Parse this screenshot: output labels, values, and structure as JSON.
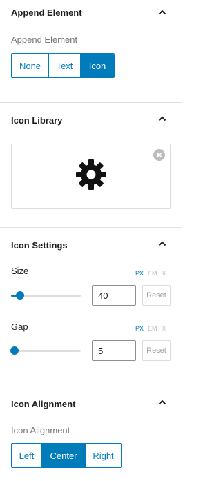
{
  "append_element": {
    "title": "Append Element",
    "field_label": "Append Element",
    "options": [
      "None",
      "Text",
      "Icon"
    ],
    "selected": "Icon"
  },
  "icon_library": {
    "title": "Icon Library",
    "icon": "gear-icon"
  },
  "icon_settings": {
    "title": "Icon Settings",
    "units": [
      "PX",
      "EM",
      "%"
    ],
    "size": {
      "label": "Size",
      "value": "40",
      "unit": "PX",
      "slider_fraction": 0.13,
      "reset_label": "Reset"
    },
    "gap": {
      "label": "Gap",
      "value": "5",
      "unit": "PX",
      "slider_fraction": 0.05,
      "reset_label": "Reset"
    }
  },
  "icon_alignment": {
    "title": "Icon Alignment",
    "field_label": "Icon Alignment",
    "options": [
      "Left",
      "Center",
      "Right"
    ],
    "selected": "Center"
  },
  "colors": {
    "accent": "#007cba",
    "border": "#e0e0e0",
    "muted_text": "#757575"
  }
}
